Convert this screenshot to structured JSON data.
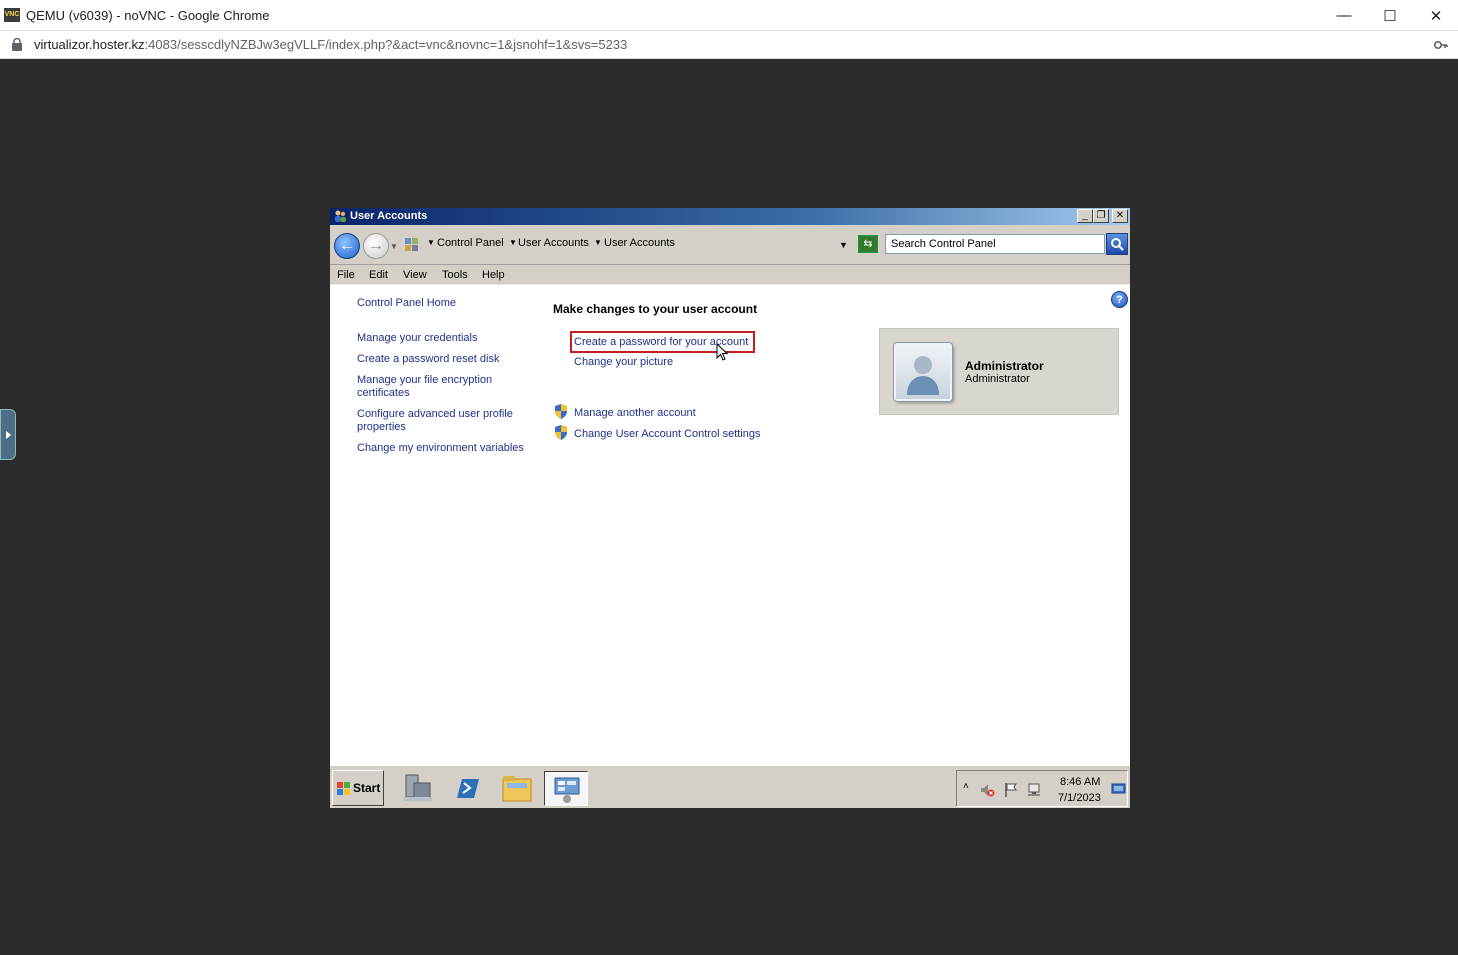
{
  "browser": {
    "tab_title": "QEMU (v6039) - noVNC - Google Chrome",
    "favicon_text": "VNC",
    "url_host": "virtualizor.hoster.kz",
    "url_rest": ":4083/sesscdlyNZBJw3egVLLF/index.php?&act=vnc&novnc=1&jsnohf=1&svs=5233",
    "minimize": "—",
    "maximize": "☐",
    "close": "✕"
  },
  "window": {
    "title": "User Accounts",
    "controls": {
      "minimize": "_",
      "restore": "❐",
      "close": "✕"
    }
  },
  "nav": {
    "back": "←",
    "forward": "→",
    "breadcrumbs": [
      "Control Panel",
      "User Accounts",
      "User Accounts"
    ],
    "search_placeholder": "Search Control Panel"
  },
  "menu": [
    "File",
    "Edit",
    "View",
    "Tools",
    "Help"
  ],
  "sidebar": {
    "home": "Control Panel Home",
    "links": [
      "Manage your credentials",
      "Create a password reset disk",
      "Manage your file encryption certificates",
      "Configure advanced user profile properties",
      "Change my environment variables"
    ]
  },
  "main": {
    "heading": "Make changes to your user account",
    "tasks": [
      "Create a password for your account",
      "Change your picture"
    ],
    "admin_tasks": [
      "Manage another account",
      "Change User Account Control settings"
    ],
    "help": "?"
  },
  "account": {
    "name": "Administrator",
    "type": "Administrator"
  },
  "taskbar": {
    "start": "Start",
    "tray_arrow": "˄",
    "time": "8:46 AM",
    "date": "7/1/2023"
  }
}
